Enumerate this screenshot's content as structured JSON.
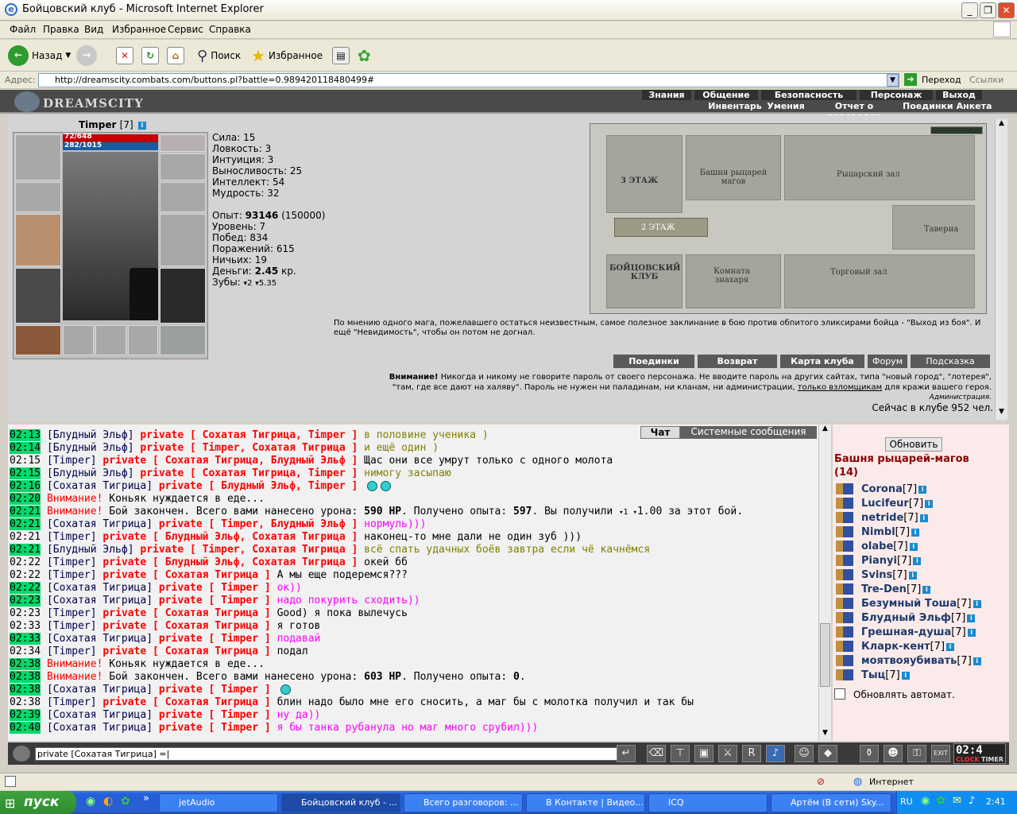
{
  "window": {
    "title": "Бойцовский клуб - Microsoft Internet Explorer",
    "minimize": "_",
    "maximize": "❐",
    "close": "✕"
  },
  "menu": [
    "Файл",
    "Правка",
    "Вид",
    "Избранное",
    "Сервис",
    "Справка"
  ],
  "toolbar": {
    "back": "Назад",
    "search": "Поиск",
    "favorites": "Избранное"
  },
  "address": {
    "label": "Адрес:",
    "url": "http://dreamscity.combats.com/buttons.pl?battle=0.989420118480499#",
    "go": "Переход",
    "links": "Ссылки"
  },
  "game_nav": {
    "logo": "DREAMSCITY",
    "top": [
      "Знания",
      "Общение",
      "Безопасность",
      "Персонаж",
      "Выход"
    ],
    "sub": [
      "Инвентарь",
      "Умения",
      "Отчет о переводах",
      "Поединки",
      "Анкета"
    ]
  },
  "character": {
    "name": "Timper",
    "level": "[7]",
    "hp": "72/648",
    "mana": "282/1015",
    "stats": [
      {
        "label": "Сила:",
        "value": "15"
      },
      {
        "label": "Ловкость:",
        "value": "3"
      },
      {
        "label": "Интуиция:",
        "value": "3"
      },
      {
        "label": "Выносливость:",
        "value": "25"
      },
      {
        "label": "Интеллект:",
        "value": "54"
      },
      {
        "label": "Мудрость:",
        "value": "32"
      }
    ],
    "exp_label": "Опыт:",
    "exp": "93146",
    "exp_next": "(150000)",
    "level_label": "Уровень:",
    "level_value": "7",
    "wins_label": "Побед:",
    "wins": "834",
    "losses_label": "Поражений:",
    "losses": "615",
    "draws_label": "Ничьих:",
    "draws": "19",
    "money_label": "Деньги:",
    "money": "2.45",
    "money_unit": "кр.",
    "teeth_label": "Зубы:",
    "teeth_a": "2",
    "teeth_b": "5.35"
  },
  "map": {
    "floor3": "3 ЭТАЖ",
    "floor2": "2 ЭТАЖ",
    "club": "БОЙЦОВСКИЙ КЛУБ",
    "tower": "Башня рыцарей магов",
    "knights": "Рыцарский зал",
    "tavern": "Таверна",
    "healer": "Комната знахаря",
    "trade": "Торговый зал"
  },
  "quote": "По мнению одного мага, пожелавшего остаться неизвестным, самое полезное заклинание в бою против обпитого эликсирами бойца - \"Выход из боя\". И ещё \"Невидимость\", чтобы он потом не догнал.",
  "action_buttons": [
    "Поединки",
    "Возврат",
    "Карта клуба",
    "Форум",
    "Подсказка"
  ],
  "warning": {
    "bold": "Внимание!",
    "text1": " Никогда и никому не говорите пароль от своего персонажа. Не вводите пароль на других сайтах, типа \"новый город\", \"лотерея\",",
    "text2": "\"там, где все дают на халяву\". Пароль не нужен ни паладинам, ни кланам, ни администрации, ",
    "link": "только взломщикам",
    "text3": " для кражи вашего героя.",
    "sign": "Администрация."
  },
  "online": "Сейчас в клубе 952 чел.",
  "chat_tabs": {
    "chat": "Чат",
    "system": "Системные сообщения"
  },
  "chat": [
    {
      "t": "02:13",
      "hl": true,
      "n": "[Блудный Эльф]",
      "p": "private [ Сохатая Тигрица, Timper ]",
      "m": "в половине ученика )",
      "c": "c6"
    },
    {
      "t": "02:14",
      "hl": true,
      "n": "[Блудный Эльф]",
      "p": "private [ Timper, Сохатая Тигрица ]",
      "m": "и ещё один )",
      "c": "c6"
    },
    {
      "t": "02:15",
      "hl": false,
      "n": "[Timper]",
      "p": "private [ Сохатая Тигрица, Блудный Эльф ]",
      "m": "Щас они все умрут только с одного молота",
      "c": "c1"
    },
    {
      "t": "02:15",
      "hl": true,
      "n": "[Блудный Эльф]",
      "p": "private [ Сохатая Тигрица, Timper ]",
      "m": "нимогу засыпаю",
      "c": "c6"
    },
    {
      "t": "02:16",
      "hl": true,
      "n": "[Сохатая Тигрица]",
      "p": "private [ Блудный Эльф, Timper ]",
      "m": "",
      "c": "c4",
      "smiles": 2
    },
    {
      "t": "02:20",
      "hl": true,
      "sys": "Внимание!",
      "m": "Коньяк нуждается в еде...",
      "c": "c1"
    },
    {
      "t": "02:21",
      "hl": true,
      "sys": "Внимание!",
      "m": "Бой закончен. Всего вами нанесено урона: ",
      "b1": "590 HP",
      "m2": ". Получено опыта: ",
      "b2": "597",
      "m3": ". Вы получили ",
      "m4": "1 ",
      "m5": "1.00 за этот бой.",
      "c": "c1"
    },
    {
      "t": "02:21",
      "hl": true,
      "n": "[Сохатая Тигрица]",
      "p": "private [ Timper, Блудный Эльф ]",
      "m": "нормуль)))",
      "c": "c4"
    },
    {
      "t": "02:21",
      "hl": false,
      "n": "[Timper]",
      "p": "private [ Блудный Эльф, Сохатая Тигрица ]",
      "m": "наконец-то мне дали не один зуб )))",
      "c": "c1"
    },
    {
      "t": "02:21",
      "hl": true,
      "n": "[Блудный Эльф]",
      "p": "private [ Timper, Сохатая Тигрица ]",
      "m": "всё спать удачных боёв завтра если чё качнёмся",
      "c": "c6"
    },
    {
      "t": "02:22",
      "hl": false,
      "n": "[Timper]",
      "p": "private [ Блудный Эльф, Сохатая Тигрица ]",
      "m": "окей бб",
      "c": "c1"
    },
    {
      "t": "02:22",
      "hl": false,
      "n": "[Timper]",
      "p": "private [ Сохатая Тигрица ]",
      "m": "А мы еще подеремся???",
      "c": "c1"
    },
    {
      "t": "02:22",
      "hl": true,
      "n": "[Сохатая Тигрица]",
      "p": "private [ Timper ]",
      "m": "ок))",
      "c": "c4"
    },
    {
      "t": "02:23",
      "hl": true,
      "n": "[Сохатая Тигрица]",
      "p": "private [ Timper ]",
      "m": "надо покурить сходить))",
      "c": "c4"
    },
    {
      "t": "02:23",
      "hl": false,
      "n": "[Timper]",
      "p": "private [ Сохатая Тигрица ]",
      "m": "Good) я пока вылечусь",
      "c": "c1"
    },
    {
      "t": "02:33",
      "hl": false,
      "n": "[Timper]",
      "p": "private [ Сохатая Тигрица ]",
      "m": "я готов",
      "c": "c1"
    },
    {
      "t": "02:33",
      "hl": true,
      "n": "[Сохатая Тигрица]",
      "p": "private [ Timper ]",
      "m": "подавай",
      "c": "c4"
    },
    {
      "t": "02:34",
      "hl": false,
      "n": "[Timper]",
      "p": "private [ Сохатая Тигрица ]",
      "m": "подал",
      "c": "c1"
    },
    {
      "t": "02:38",
      "hl": true,
      "sys": "Внимание!",
      "m": "Коньяк нуждается в еде...",
      "c": "c1"
    },
    {
      "t": "02:38",
      "hl": true,
      "sys": "Внимание!",
      "m": "Бой закончен. Всего вами нанесено урона: ",
      "b1": "603 HP",
      "m2": ". Получено опыта: ",
      "b2": "0",
      "m3": ".",
      "c": "c1"
    },
    {
      "t": "02:38",
      "hl": true,
      "n": "[Сохатая Тигрица]",
      "p": "private [ Timper ]",
      "m": "",
      "c": "c4",
      "smiles": 1
    },
    {
      "t": "02:38",
      "hl": false,
      "n": "[Timper]",
      "p": "private [ Сохатая Тигрица ]",
      "m": "блин надо было мне его сносить, а маг бы с молотка получил и так бы",
      "c": "c1"
    },
    {
      "t": "02:39",
      "hl": true,
      "n": "[Сохатая Тигрица]",
      "p": "private [ Timper ]",
      "m": "ну да))",
      "c": "c4"
    },
    {
      "t": "02:40",
      "hl": true,
      "n": "[Сохатая Тигрица]",
      "p": "private [ Timper ]",
      "m": "я бы танка рубанула но маг много срубил)))",
      "c": "c4"
    }
  ],
  "room": {
    "refresh": "Обновить",
    "title": "Башня рыцарей-магов",
    "count": "(14)",
    "auto": "Обновлять автомат.",
    "users": [
      {
        "name": "Corona",
        "lv": "[7]"
      },
      {
        "name": "Lucifeur",
        "lv": "[7]"
      },
      {
        "name": "netride",
        "lv": "[7]"
      },
      {
        "name": "Nimbl",
        "lv": "[7]"
      },
      {
        "name": "olabe",
        "lv": "[7]"
      },
      {
        "name": "Pianyi",
        "lv": "[7]"
      },
      {
        "name": "Svins",
        "lv": "[7]"
      },
      {
        "name": "Tre-Den",
        "lv": "[7]"
      },
      {
        "name": "Безумный Тоша",
        "lv": "[7]"
      },
      {
        "name": "Блудный Эльф",
        "lv": "[7]"
      },
      {
        "name": "Грешная-душа",
        "lv": "[7]"
      },
      {
        "name": "Кларк-кент",
        "lv": "[7]"
      },
      {
        "name": "моятвояубивать",
        "lv": "[7]"
      },
      {
        "name": "Тыц",
        "lv": "[7]"
      }
    ]
  },
  "input": {
    "value": "private [Сохатая Тигрица] =|"
  },
  "clock": {
    "time": "02:4",
    "label1": "CLOCK",
    "label2": "TIMER"
  },
  "status": {
    "zone": "Интернет"
  },
  "taskbar": {
    "start": "пуск",
    "tasks": [
      "jetAudio",
      "Бойцовский клуб - ...",
      "Всего разговоров: ...",
      "В Контакте | Видео...",
      "ICQ",
      "Артём (В сети) Sky..."
    ],
    "lang": "RU",
    "time": "2:41"
  }
}
